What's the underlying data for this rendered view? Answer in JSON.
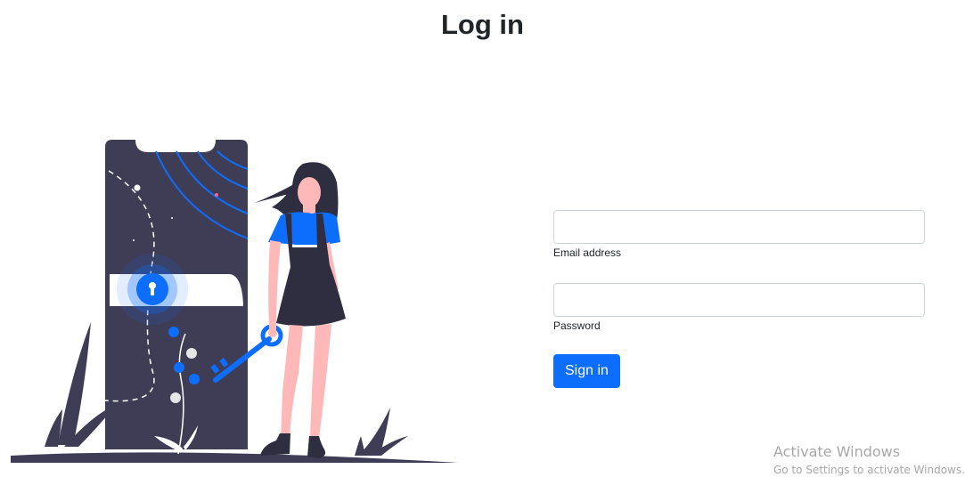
{
  "page": {
    "title": "Log in"
  },
  "form": {
    "email": {
      "label": "Email address",
      "value": "",
      "placeholder": ""
    },
    "password": {
      "label": "Password",
      "value": "",
      "placeholder": ""
    },
    "submit_label": "Sign in"
  },
  "illustration": {
    "icon": "woman-with-key-unlocking-phone-illustration",
    "colors": {
      "phone": "#3f3d56",
      "accent": "#0d6efd",
      "hair": "#2f2e41",
      "skin": "#ffb8b8",
      "dress": "#2f2e41",
      "ground": "#3f3d56"
    }
  },
  "windows_watermark": {
    "title": "Activate Windows",
    "subtitle": "Go to Settings to activate Windows."
  },
  "theme": {
    "primary": "#0d6efd",
    "border": "#ced4da",
    "text": "#212529"
  }
}
